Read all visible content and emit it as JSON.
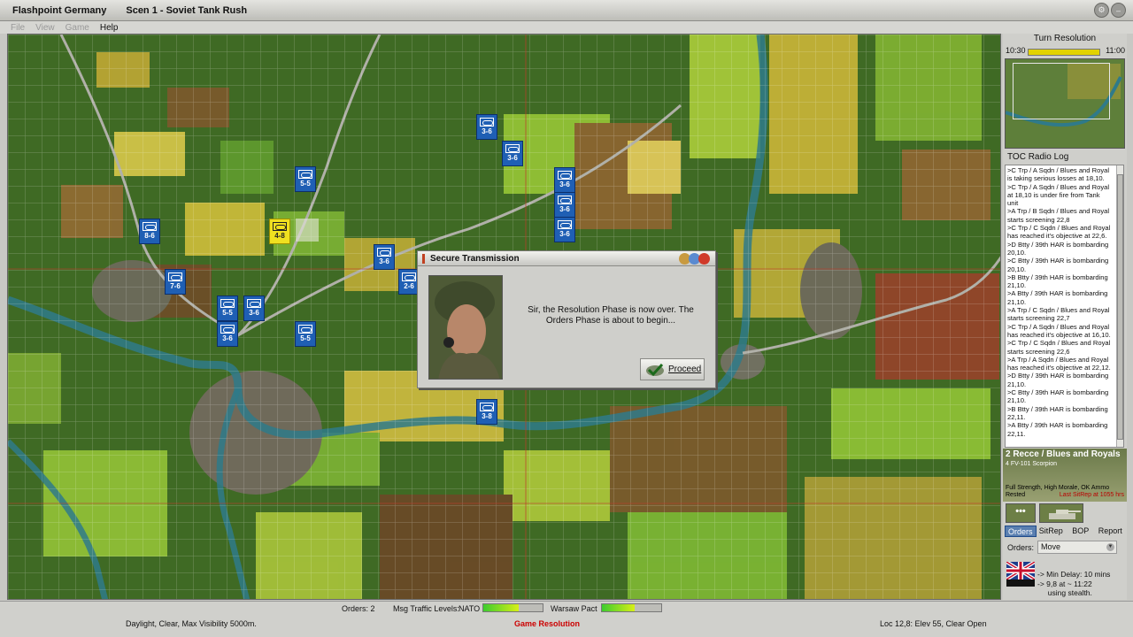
{
  "window": {
    "app_title": "Flashpoint Germany",
    "scenario_title": "Scen 1 - Soviet Tank Rush"
  },
  "menu": {
    "file": "File",
    "view": "View",
    "game": "Game",
    "help": "Help"
  },
  "map": {
    "units": [
      {
        "id": "u1",
        "strength": "3-6"
      },
      {
        "id": "u2",
        "strength": "3-6"
      },
      {
        "id": "u3",
        "strength": "5-5"
      },
      {
        "id": "u4",
        "strength": "3-6"
      },
      {
        "id": "u5",
        "strength": "3-6"
      },
      {
        "id": "u6",
        "strength": "3-6"
      },
      {
        "id": "u7",
        "strength": "8-6"
      },
      {
        "id": "u8",
        "strength": "4-8",
        "selected": true
      },
      {
        "id": "u9",
        "strength": "3-6"
      },
      {
        "id": "u10",
        "strength": "7-6"
      },
      {
        "id": "u11",
        "strength": "2-6"
      },
      {
        "id": "u12",
        "strength": "5-5"
      },
      {
        "id": "u13",
        "strength": "3-6"
      },
      {
        "id": "u14",
        "strength": "3-6"
      },
      {
        "id": "u15",
        "strength": "5-5"
      },
      {
        "id": "u16",
        "strength": "3-8"
      }
    ]
  },
  "dialog": {
    "title": "Secure Transmission",
    "message": "Sir, the Resolution Phase is now over.  The Orders Phase is about to begin...",
    "proceed_label": "Proceed"
  },
  "turn": {
    "label": "Turn Resolution",
    "start": "10:30",
    "end": "11:00"
  },
  "radio_log": {
    "title": "TOC Radio Log",
    "entries": [
      ">C Trp / A Sqdn / Blues and Royal is taking serious losses at 18,10.",
      ">C Trp / A Sqdn / Blues and Royal at 18,10 is under fire from Tank unit",
      ">A Trp / B Sqdn / Blues and Royal starts screening 22,8",
      ">C Trp / C Sqdn / Blues and Royal has reached it's objective at 22,6.",
      ">D Btty / 39th HAR is bombarding 20,10.",
      ">C Btty / 39th HAR is bombarding 20,10.",
      ">B Btty / 39th HAR is bombarding 21,10.",
      ">A Btty / 39th HAR is bombarding 21,10.",
      ">A Trp / C Sqdn / Blues and Royal starts screening 22,7",
      ">C Trp / A Sqdn / Blues and Royal has reached it's objective at 16,10.",
      ">C Trp / C Sqdn / Blues and Royal starts screening 22,6",
      ">A Trp / A Sqdn / Blues and Royal has reached it's objective at 22,12.",
      ">D Btty / 39th HAR is bombarding 21,10.",
      ">C Btty / 39th HAR is bombarding 21,10.",
      ">B Btty / 39th HAR is bombarding 22,11.",
      ">A Btty / 39th HAR is bombarding 22,11."
    ]
  },
  "unit_info": {
    "name": "2 Recce / Blues and Royals",
    "equipment": "4 FV-101 Scorpion",
    "status1": "Full Strength, High Morale, OK Ammo",
    "status2": "Rested",
    "sitrep": "Last SitRep at 1055 hrs",
    "dots": "•••"
  },
  "tabs": [
    "Orders",
    "SitRep",
    "BOP",
    "Report"
  ],
  "orders": {
    "label": "Orders:",
    "selected": "Move",
    "details": "-> Min Delay: 10 mins\n-> 9,8 at ~ 11:22\n     using stealth."
  },
  "status": {
    "orders": "Orders: 2",
    "msg_traffic_label": "Msg Traffic Levels:",
    "nato_label": "NATO",
    "nato_level": 0.6,
    "pact_label": "Warsaw Pact",
    "pact_level": 0.55,
    "conditions": "Daylight, Clear, Max Visibility 5000m.",
    "phase": "Game Resolution",
    "location": "Loc 12,8: Elev 55, Clear Open"
  },
  "colors": {
    "nato_blue": "#1f5fb4",
    "selected_unit": "#f0e020",
    "phase_red": "#c00000",
    "tab_active": "#5a7fb0"
  }
}
